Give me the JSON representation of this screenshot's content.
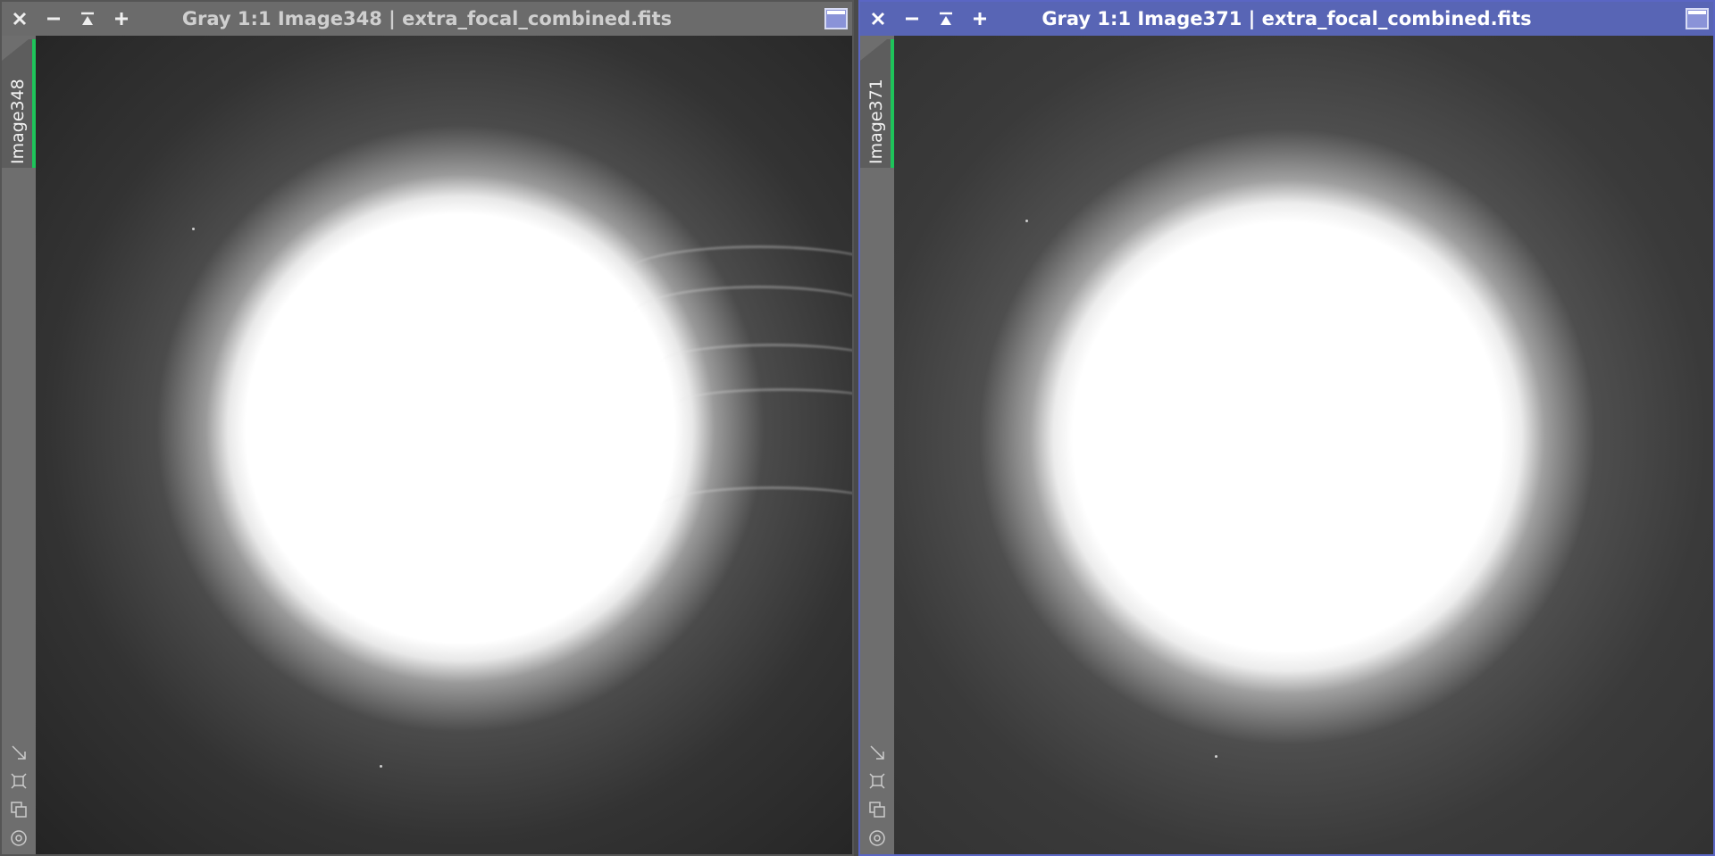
{
  "windows": [
    {
      "title": "Gray 1:1 Image348 | extra_focal_combined.fits",
      "tab_label": "Image348",
      "active": false,
      "titlebar_color": "#6b6b6b"
    },
    {
      "title": "Gray 1:1 Image371 | extra_focal_combined.fits",
      "tab_label": "Image371",
      "active": true,
      "titlebar_color": "#5865b5"
    }
  ],
  "titlebar_buttons": [
    "close-icon",
    "minimize-icon",
    "shade-icon",
    "maximize-plus-icon"
  ],
  "sidebar_tools": [
    "resize-arrow-icon",
    "fit-view-icon",
    "clone-view-icon",
    "target-icon"
  ],
  "colors": {
    "active_accent": "#5865b5",
    "tab_indicator": "#1ec45a"
  }
}
